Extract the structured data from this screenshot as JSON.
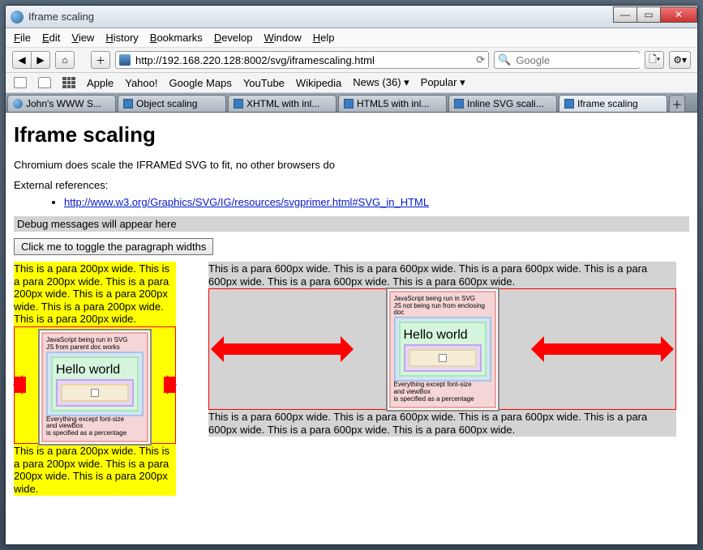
{
  "window": {
    "title": "Iframe scaling"
  },
  "menu": [
    "File",
    "Edit",
    "View",
    "History",
    "Bookmarks",
    "Develop",
    "Window",
    "Help"
  ],
  "url": "http://192.168.220.128:8002/svg/iframescaling.html",
  "search_placeholder": "Google",
  "bookmarks": [
    "Apple",
    "Yahoo!",
    "Google Maps",
    "YouTube",
    "Wikipedia",
    "News (36) ▾",
    "Popular ▾"
  ],
  "tabs": [
    {
      "label": "John's WWW S...",
      "type": "globe"
    },
    {
      "label": "Object scaling"
    },
    {
      "label": "XHTML with inl..."
    },
    {
      "label": "HTML5 with inl..."
    },
    {
      "label": "Inline SVG scali..."
    },
    {
      "label": "Iframe scaling",
      "active": true
    }
  ],
  "page": {
    "h1": "Iframe scaling",
    "p1": "Chromium does scale the IFRAMEd SVG to fit, no other browsers do",
    "p2": "External references:",
    "link": "http://www.w3.org/Graphics/SVG/IG/resources/svgprimer.html#SVG_in_HTML",
    "debug": "Debug messages will appear here",
    "toggle": "Click me to toggle the paragraph widths",
    "para200": "This is a para 200px wide. This is a para 200px wide. This is a para 200px wide. This is a para 200px wide. This is a para 200px wide. This is a para 200px wide.",
    "para200b": "This is a para 200px wide. This is a para 200px wide. This is a para 200px wide. This is a para 200px wide.",
    "para600": "This is a para 600px wide. This is a para 600px wide. This is a para 600px wide. This is a para 600px wide. This is a para 600px wide. This is a para 600px wide.",
    "svg": {
      "l1a": "JavaScript being run in SVG",
      "l1b_left": "JS from parent doc works",
      "l1b_right": "JS not being run from enclosing doc",
      "hello": "Hello world",
      "l3": "Everything except font-size",
      "l4": "and viewBox",
      "l5": "is specified as a percentage"
    }
  }
}
